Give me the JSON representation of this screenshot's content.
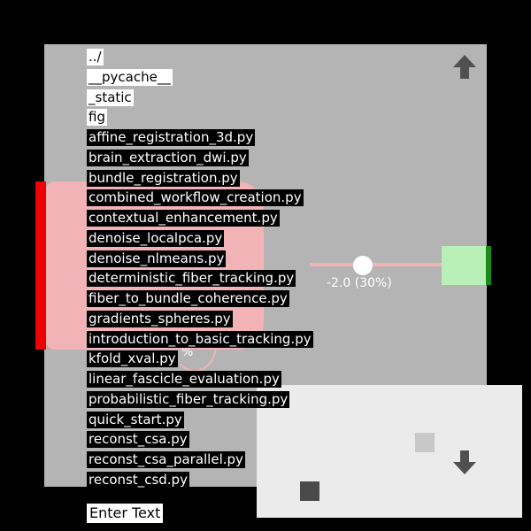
{
  "file_list": {
    "items": [
      {
        "label": "../",
        "type": "dir"
      },
      {
        "label": "__pycache__",
        "type": "dir"
      },
      {
        "label": "_static",
        "type": "dir"
      },
      {
        "label": "fig",
        "type": "dir"
      },
      {
        "label": "affine_registration_3d.py",
        "type": "file"
      },
      {
        "label": "brain_extraction_dwi.py",
        "type": "file"
      },
      {
        "label": "bundle_registration.py",
        "type": "file"
      },
      {
        "label": "combined_workflow_creation.py",
        "type": "file"
      },
      {
        "label": "contextual_enhancement.py",
        "type": "file"
      },
      {
        "label": "denoise_localpca.py",
        "type": "file"
      },
      {
        "label": "denoise_nlmeans.py",
        "type": "file"
      },
      {
        "label": "deterministic_fiber_tracking.py",
        "type": "file"
      },
      {
        "label": "fiber_to_bundle_coherence.py",
        "type": "file"
      },
      {
        "label": "gradients_spheres.py",
        "type": "file"
      },
      {
        "label": "introduction_to_basic_tracking.py",
        "type": "file"
      },
      {
        "label": "kfold_xval.py",
        "type": "file"
      },
      {
        "label": "linear_fascicle_evaluation.py",
        "type": "file"
      },
      {
        "label": "probabilistic_fiber_tracking.py",
        "type": "file"
      },
      {
        "label": "quick_start.py",
        "type": "file"
      },
      {
        "label": "reconst_csa.py",
        "type": "file"
      },
      {
        "label": "reconst_csa_parallel.py",
        "type": "file"
      },
      {
        "label": "reconst_csd.py",
        "type": "file"
      }
    ]
  },
  "slider": {
    "label": "-2.0 (30%)",
    "value_percent": 30
  },
  "stray_text": "%",
  "text_input": {
    "value": "Enter Text"
  },
  "icons": {
    "scroll_up": "arrow-up-icon",
    "scroll_down": "arrow-down-icon"
  },
  "colors": {
    "panel": "#b4b4b4",
    "dir_bg": "#ffffff",
    "file_bg": "#000000",
    "red_bar": "#ee0000",
    "pink": "#f2b3b6",
    "green_box": "#b8f0b8",
    "green_bar": "#1b8a1b",
    "overlay": "#ebebeb"
  }
}
